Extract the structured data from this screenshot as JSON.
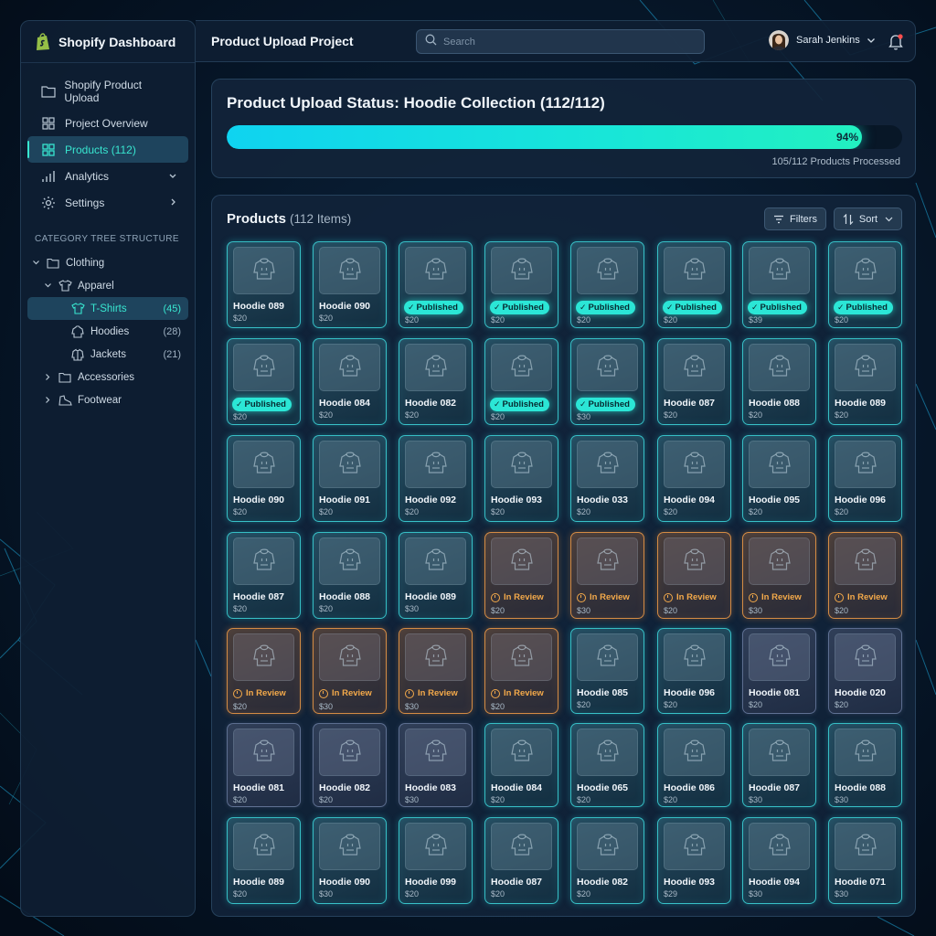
{
  "brand": {
    "title": "Shopify Dashboard",
    "accent": "#38e6d0",
    "logo_color": "#95bf47"
  },
  "nav": {
    "items": [
      {
        "label": "Shopify Product Upload",
        "icon": "folder-icon"
      },
      {
        "label": "Project Overview",
        "icon": "grid-icon"
      },
      {
        "label": "Products (112)",
        "icon": "grid-icon",
        "active": true
      },
      {
        "label": "Analytics",
        "icon": "bar-chart-icon",
        "chevron": "down"
      },
      {
        "label": "Settings",
        "icon": "gear-icon",
        "chevron": "right"
      }
    ]
  },
  "category_tree": {
    "label": "CATEGORY TREE STRUCTURE",
    "items": [
      {
        "label": "Clothing",
        "icon": "folder-icon",
        "caret": "down"
      },
      {
        "label": "Apparel",
        "icon": "tshirt-icon",
        "caret": "down"
      },
      {
        "label": "T-Shirts",
        "icon": "tshirt-icon",
        "count": "(45)",
        "selected": true
      },
      {
        "label": "Hoodies",
        "icon": "hoodie-icon",
        "count": "(28)"
      },
      {
        "label": "Jackets",
        "icon": "jacket-icon",
        "count": "(21)"
      },
      {
        "label": "Accessories",
        "icon": "folder-icon",
        "caret": "right"
      },
      {
        "label": "Footwear",
        "icon": "shoe-icon",
        "caret": "right"
      }
    ]
  },
  "header": {
    "title": "Product Upload Project",
    "search_placeholder": "Search",
    "user_name": "Sarah Jenkins"
  },
  "status": {
    "title": "Product Upload Status: Hoodie Collection (112/112)",
    "progress_percent": 94,
    "progress_label": "94%",
    "processed_text": "105/112 Products Processed"
  },
  "products": {
    "title": "Products",
    "count_text": "(112 Items)",
    "filters_label": "Filters",
    "sort_label": "Sort",
    "published_label": "Published",
    "in_review_label": "In Review",
    "rows": [
      [
        {
          "name": "Hoodie 089",
          "price": "$20",
          "status": "none"
        },
        {
          "name": "Hoodie 090",
          "price": "$20",
          "status": "none"
        },
        {
          "name": "",
          "price": "$20",
          "status": "published"
        },
        {
          "name": "",
          "price": "$20",
          "status": "published"
        },
        {
          "name": "",
          "price": "$20",
          "status": "published"
        },
        {
          "name": "",
          "price": "$20",
          "status": "published"
        },
        {
          "name": "",
          "price": "$39",
          "status": "published"
        },
        {
          "name": "",
          "price": "$20",
          "status": "published"
        }
      ],
      [
        {
          "name": "",
          "price": "$20",
          "status": "published"
        },
        {
          "name": "Hoodie 084",
          "price": "$20",
          "status": "none"
        },
        {
          "name": "Hoodie 082",
          "price": "$20",
          "status": "none"
        },
        {
          "name": "",
          "price": "$20",
          "status": "published"
        },
        {
          "name": "",
          "price": "$30",
          "status": "published"
        },
        {
          "name": "Hoodie 087",
          "price": "$20",
          "status": "none"
        },
        {
          "name": "Hoodie 088",
          "price": "$20",
          "status": "none"
        },
        {
          "name": "Hoodie 089",
          "price": "$20",
          "status": "none"
        }
      ],
      [
        {
          "name": "Hoodie 090",
          "price": "$20",
          "status": "none"
        },
        {
          "name": "Hoodie 091",
          "price": "$20",
          "status": "none"
        },
        {
          "name": "Hoodie 092",
          "price": "$20",
          "status": "none"
        },
        {
          "name": "Hoodie 093",
          "price": "$20",
          "status": "none"
        },
        {
          "name": "Hoodie 033",
          "price": "$20",
          "status": "none"
        },
        {
          "name": "Hoodie 094",
          "price": "$20",
          "status": "none"
        },
        {
          "name": "Hoodie 095",
          "price": "$20",
          "status": "none"
        },
        {
          "name": "Hoodie 096",
          "price": "$20",
          "status": "none"
        }
      ],
      [
        {
          "name": "Hoodie 087",
          "price": "$20",
          "status": "none"
        },
        {
          "name": "Hoodie 088",
          "price": "$20",
          "status": "none"
        },
        {
          "name": "Hoodie 089",
          "price": "$30",
          "status": "none"
        },
        {
          "name": "",
          "price": "$20",
          "status": "review"
        },
        {
          "name": "",
          "price": "$30",
          "status": "review"
        },
        {
          "name": "",
          "price": "$20",
          "status": "review"
        },
        {
          "name": "",
          "price": "$30",
          "status": "review"
        },
        {
          "name": "",
          "price": "$20",
          "status": "review"
        }
      ],
      [
        {
          "name": "",
          "price": "$20",
          "status": "review"
        },
        {
          "name": "",
          "price": "$30",
          "status": "review"
        },
        {
          "name": "",
          "price": "$30",
          "status": "review"
        },
        {
          "name": "",
          "price": "$20",
          "status": "review"
        },
        {
          "name": "Hoodie 085",
          "price": "$20",
          "status": "none"
        },
        {
          "name": "Hoodie 096",
          "price": "$20",
          "status": "none"
        },
        {
          "name": "Hoodie 081",
          "price": "$20",
          "status": "plain"
        },
        {
          "name": "Hoodie 020",
          "price": "$20",
          "status": "plain"
        }
      ],
      [
        {
          "name": "Hoodie 081",
          "price": "$20",
          "status": "plain"
        },
        {
          "name": "Hoodie 082",
          "price": "$20",
          "status": "plain"
        },
        {
          "name": "Hoodie 083",
          "price": "$30",
          "status": "plain"
        },
        {
          "name": "Hoodie 084",
          "price": "$20",
          "status": "none"
        },
        {
          "name": "Hoodie 065",
          "price": "$20",
          "status": "none"
        },
        {
          "name": "Hoodie 086",
          "price": "$20",
          "status": "none"
        },
        {
          "name": "Hoodie 087",
          "price": "$30",
          "status": "none"
        },
        {
          "name": "Hoodie 088",
          "price": "$30",
          "status": "none"
        }
      ],
      [
        {
          "name": "Hoodie 089",
          "price": "$20",
          "status": "none"
        },
        {
          "name": "Hoodie 090",
          "price": "$30",
          "status": "none"
        },
        {
          "name": "Hoodie 099",
          "price": "$20",
          "status": "none"
        },
        {
          "name": "Hoodie 087",
          "price": "$20",
          "status": "none"
        },
        {
          "name": "Hoodie 082",
          "price": "$20",
          "status": "none"
        },
        {
          "name": "Hoodie 093",
          "price": "$29",
          "status": "none"
        },
        {
          "name": "Hoodie 094",
          "price": "$30",
          "status": "none"
        },
        {
          "name": "Hoodie 071",
          "price": "$30",
          "status": "none"
        }
      ]
    ]
  }
}
